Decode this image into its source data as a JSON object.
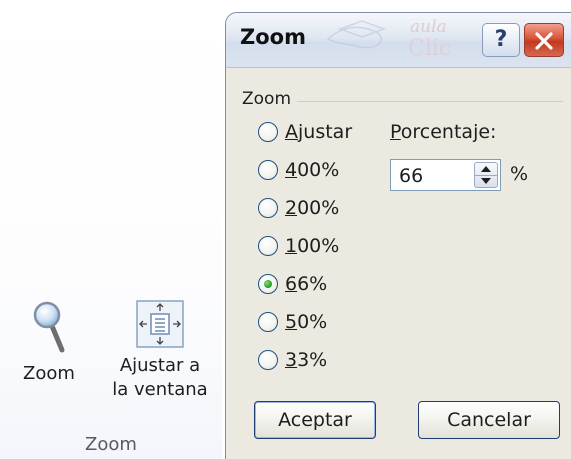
{
  "ribbon": {
    "zoom_label": "Zoom",
    "fit_label_line1": "Ajustar a",
    "fit_label_line2": "la ventana",
    "group_label": "Zoom"
  },
  "dialog": {
    "title": "Zoom",
    "watermark_top": "aula",
    "watermark_bottom": "Clic",
    "help_label": "?",
    "group_label": "Zoom",
    "options": [
      {
        "pre": "",
        "u": "A",
        "post": "justar",
        "checked": false
      },
      {
        "pre": "",
        "u": "4",
        "post": "00%",
        "checked": false
      },
      {
        "pre": "",
        "u": "2",
        "post": "00%",
        "checked": false
      },
      {
        "pre": "",
        "u": "1",
        "post": "00%",
        "checked": false
      },
      {
        "pre": "",
        "u": "6",
        "post": "6%",
        "checked": true
      },
      {
        "pre": "",
        "u": "5",
        "post": "0%",
        "checked": false
      },
      {
        "pre": "",
        "u": "3",
        "post": "3%",
        "checked": false
      }
    ],
    "percent_label_u": "P",
    "percent_label_rest": "orcentaje:",
    "percent_value": "66",
    "percent_suffix": "%",
    "ok_label": "Aceptar",
    "cancel_label": "Cancelar"
  },
  "colors": {
    "dialog_bg": "#eceae0",
    "close_red": "#d9533b",
    "radio_checked": "#2ca02c"
  }
}
